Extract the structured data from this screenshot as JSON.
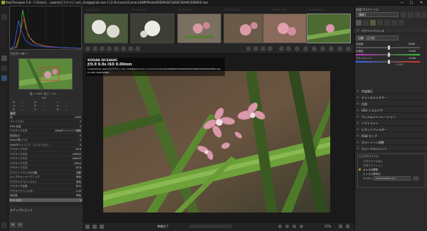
{
  "window": {
    "title": "RawTherapee 5.8 - C:\\Users\\... awano\\ピクチャ\\ [ vari_chat@gmail.com ]   (1)  N:\\canon\\Camera\\DNP\\Photo\\KODAK\\DCS460C\\K0A0C000810.raw",
    "minimize": "—",
    "maximize": "□",
    "close": "✕"
  },
  "left": {
    "vtabs": [
      "ファイルブラウザ",
      "編集",
      "キュー"
    ],
    "navigator_label": "ナビゲーター",
    "nav_size": "幅 = 1080, 高さ = 20 ...",
    "nav_coords_label": "ラボ",
    "nav_values": {
      "r": "R:",
      "g": "G:",
      "b": "B:",
      "h": "H:",
      "s": "S:",
      "v": "V:",
      "l": "L:",
      "a": "a:",
      "b2": "b:",
      "rv": "--",
      "gv": "--",
      "bv": "--",
      "hv": "--",
      "sv": "--",
      "vv": "--",
      "lv": "--",
      "av": "--",
      "b2v": "--"
    },
    "history_label": "履歴",
    "history": [
      {
        "k": "源",
        "v": "1080"
      },
      {
        "k": "コントラスト",
        "v": "0"
      },
      {
        "k": "RGB 色差",
        "v": "0"
      },
      {
        "k": "デモザイク方式",
        "v": "AMaZEバイリニア補間"
      },
      {
        "k": "偽色除去",
        "v": "0"
      },
      {
        "k": "Rawの黒レベル",
        "v": "0"
      },
      {
        "k": "AMaZEバイリニア（コントラスト...",
        "v": "0"
      },
      {
        "k": "デモザイク方式",
        "v": "DCB"
      },
      {
        "k": "デモザイク方式",
        "v": "LMMSE"
      },
      {
        "k": "デモザイク方式",
        "v": "AMaZE"
      },
      {
        "k": "デモザイク方式",
        "v": "VNG4"
      },
      {
        "k": "デモザイク方式",
        "v": "DCB"
      },
      {
        "k": "ホワイトバランスの自動",
        "v": "自動"
      },
      {
        "k": "キャプチャシャープニング",
        "v": "有効"
      },
      {
        "k": "デモザイクコントラスト",
        "v": "有効"
      },
      {
        "k": "デモザイク処理",
        "v": "RCD"
      },
      {
        "k": "デモザイクフィルター",
        "v": "1.00"
      },
      {
        "k": "色収差",
        "v": "有効"
      },
      {
        "k": "RGB 色差",
        "v": "0"
      }
    ],
    "snapshot_label": "スナップショット",
    "snapshot_buttons": [
      "+",
      "−"
    ]
  },
  "filmstrip": {
    "stars": [
      "☆☆☆☆☆",
      "☆☆☆☆☆",
      "☆☆☆☆☆",
      "☆☆☆☆☆",
      "☆☆☆☆☆",
      "☆☆☆☆☆"
    ]
  },
  "overlay": {
    "camera": "KODAK DCS460C",
    "exposure": "ƒ/0.0  0.0s  ISO 0.00mm",
    "path": "C:\\Users\\vari_awano\\ピクチャ\\ [ vari_chat@gmail.com ]  (1)  N:\\canon\\Camera\\DNP\\Photo\\KODAK\\DCS460C\\K0A0C000810.raw",
    "size": "6.2 MP (3060x2040)"
  },
  "bottom": {
    "status": "準備完了",
    "zoom": "17%",
    "buttons": [
      "保存",
      "キュー",
      "外部"
    ]
  },
  "right": {
    "profile_label": "処理プロファイル",
    "profile_value": "(最新)",
    "tabs": [
      "露光",
      "ディテール",
      "カラー",
      "高度",
      "変形",
      "RAW",
      "メタデータ"
    ],
    "wb_header": "ホワイトバランス",
    "wb_method": "自動 - 正方形",
    "wb_temp_label": "色温度",
    "wb_temp": "5065",
    "wb_tint_label": "色偏差",
    "wb_tint": "1.000",
    "wb_tint2_label": "ブルー/レッド",
    "wb_tint2": "1.000",
    "wb_equal": "1.000",
    "sections": [
      "色度補正",
      "チャンネルミキサー",
      "白黒",
      "HSV イコライザ",
      "フィルムシミュレーション",
      "ソフトライト",
      "ビネットフィルター",
      "RGB カーブ",
      "カラートーン調整",
      "カラーマネジメント"
    ],
    "cm_input_label": "入力プロファイル",
    "cm_options": [
      "プロファイルなし",
      "カメラの標準",
      "カメラの標準的",
      "カスタム"
    ],
    "cm_options_disabled": [
      "共通プロファイル",
      ""
    ],
    "cm_custom_file": "K0A0C000810.dcp"
  },
  "colors": {
    "accent": "#d0a040",
    "bg": "#2a2a2a",
    "panel": "#2c2c2c",
    "histogram_r": "#d33",
    "histogram_g": "#3c3",
    "histogram_b": "#36f"
  }
}
